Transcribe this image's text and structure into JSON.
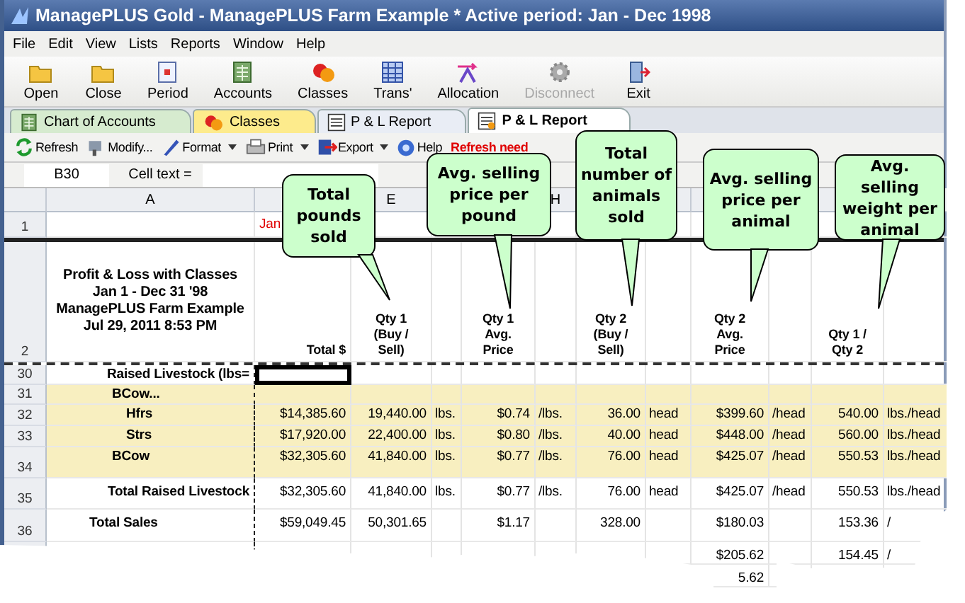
{
  "window": {
    "title": "ManagePLUS Gold - ManagePLUS Farm Example * Active period: Jan - Dec 1998"
  },
  "menu": [
    "File",
    "Edit",
    "View",
    "Lists",
    "Reports",
    "Window",
    "Help"
  ],
  "toolbar": [
    {
      "label": "Open",
      "disabled": false
    },
    {
      "label": "Close",
      "disabled": false
    },
    {
      "label": "Period",
      "disabled": false
    },
    {
      "label": "Accounts",
      "disabled": false
    },
    {
      "label": "Classes",
      "disabled": false
    },
    {
      "label": "Trans'",
      "disabled": false
    },
    {
      "label": "Allocation",
      "disabled": false
    },
    {
      "label": "Disconnect",
      "disabled": true
    },
    {
      "label": "Exit",
      "disabled": false
    }
  ],
  "tabs": [
    {
      "label": "Chart of Accounts",
      "selected": false,
      "color": "#d6ebcf"
    },
    {
      "label": "Classes",
      "selected": false,
      "color": "#fdeb8c"
    },
    {
      "label": "P & L Report",
      "selected": false,
      "color": "#e9edf5"
    },
    {
      "label": "P & L Report",
      "selected": true,
      "color": "#ffffff"
    }
  ],
  "report_toolbar": {
    "buttons": [
      {
        "label": "Refresh",
        "dropdown": false
      },
      {
        "label": "Modify...",
        "dropdown": false
      },
      {
        "label": "Format",
        "dropdown": true
      },
      {
        "label": "Print",
        "dropdown": true
      },
      {
        "label": "Export",
        "dropdown": true
      },
      {
        "label": "Help",
        "dropdown": false
      }
    ],
    "notice": "Refresh need"
  },
  "cell_bar": {
    "cell": "B30",
    "label": "Cell text ="
  },
  "sheet": {
    "column_letters": {
      "label": "A",
      "qty1": "E",
      "unit2": "H"
    },
    "row_1": {
      "number": "1",
      "total": "Jan"
    },
    "row_2": {
      "number": "2",
      "title": "Profit & Loss with Classes\nJan 1 - Dec 31 '98\nManagePLUS Farm Example\nJul 29, 2011  8:53 PM",
      "headers": {
        "total": "Total $",
        "qty1": "Qty 1\n(Buy /\nSell)",
        "price1": "Qty 1\nAvg.\nPrice",
        "qty2": "Qty 2\n(Buy /\nSell)",
        "price2": "Qty 2\nAvg.\nPrice",
        "ratio": "Qty 1 /\nQty 2"
      }
    },
    "rows": [
      {
        "number": "30",
        "kind": "section",
        "label": "Raised Livestock (lbs=",
        "selected": true,
        "cells": {}
      },
      {
        "number": "31",
        "kind": "group",
        "label": "BCow...",
        "selected": false,
        "cells": {}
      },
      {
        "number": "32",
        "kind": "item",
        "label": "Hfrs",
        "selected": false,
        "cells": {
          "total": "$14,385.60",
          "qty1": "19,440.00",
          "unit1": "lbs.",
          "price1": "$0.74",
          "unit2": "/lbs.",
          "qty2": "36.00",
          "unit3": "head",
          "price2": "$399.60",
          "unit4": "/head",
          "ratio": "540.00",
          "unit5": "lbs./head"
        }
      },
      {
        "number": "33",
        "kind": "item",
        "label": "Strs",
        "selected": false,
        "cells": {
          "total": "$17,920.00",
          "qty1": "22,400.00",
          "unit1": "lbs.",
          "price1": "$0.80",
          "unit2": "/lbs.",
          "qty2": "40.00",
          "unit3": "head",
          "price2": "$448.00",
          "unit4": "/head",
          "ratio": "560.00",
          "unit5": "lbs./head"
        }
      },
      {
        "number": "34",
        "kind": "group",
        "label": "BCow",
        "selected": false,
        "cells": {
          "total": "$32,305.60",
          "qty1": "41,840.00",
          "unit1": "lbs.",
          "price1": "$0.77",
          "unit2": "/lbs.",
          "qty2": "76.00",
          "unit3": "head",
          "price2": "$425.07",
          "unit4": "/head",
          "ratio": "550.53",
          "unit5": "lbs./head"
        }
      },
      {
        "number": "35",
        "kind": "total",
        "label": "Total Raised Livestock",
        "selected": false,
        "cells": {
          "total": "$32,305.60",
          "qty1": "41,840.00",
          "unit1": "lbs.",
          "price1": "$0.77",
          "unit2": "/lbs.",
          "qty2": "76.00",
          "unit3": "head",
          "price2": "$425.07",
          "unit4": "/head",
          "ratio": "550.53",
          "unit5": "lbs./head"
        }
      },
      {
        "number": "36",
        "kind": "grand",
        "label": "Total Sales",
        "selected": false,
        "cells": {
          "total": "$59,049.45",
          "qty1": "50,301.65",
          "price1": "$1.17",
          "qty2": "328.00",
          "price2": "$180.03",
          "ratio": "153.36",
          "unit5": "/"
        }
      },
      {
        "kind": "grand",
        "cells": {
          "price2": "$205.62",
          "ratio": "154.45",
          "unit5": "/"
        }
      },
      {
        "kind": "grand",
        "cells": {
          "price2": "5.62"
        }
      }
    ]
  },
  "callouts": [
    "Total\npounds\nsold",
    "Avg. selling\nprice per\npound",
    "Total\nnumber of\nanimals\nsold",
    "Avg. selling\nprice per\nanimal",
    "Avg. selling\nweight per\nanimal"
  ]
}
